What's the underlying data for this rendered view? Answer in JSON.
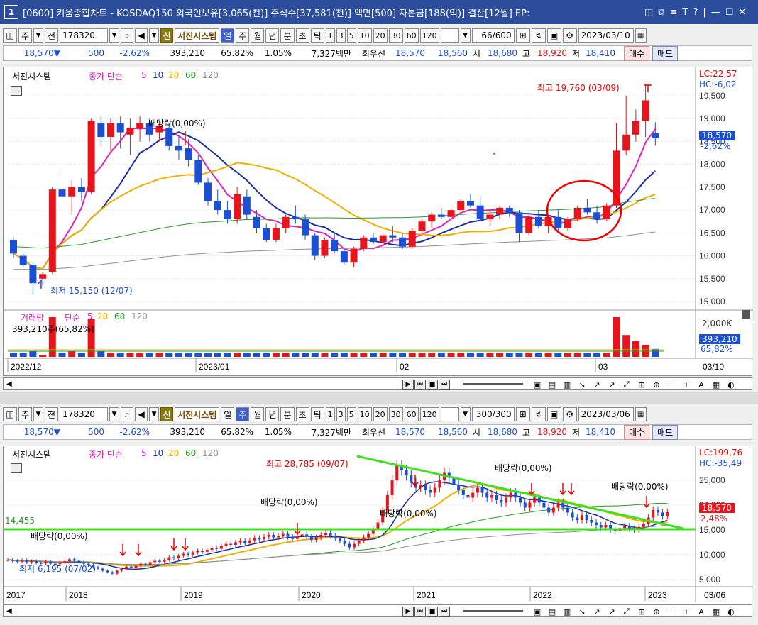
{
  "window": {
    "num": "1",
    "title": "[0600] 키움종합차트 - KOSDAQ150 외국인보유[3,065(천)] 주식수[37,581(천)] 액면[500] 자본금[188(억)] 결산[12월] EP:",
    "controls": [
      "◫",
      "⧉",
      "≡",
      "T",
      "?",
      "|",
      "—",
      "☐",
      "✕"
    ]
  },
  "panes": [
    {
      "toolbar": {
        "period": "주",
        "mode": "전",
        "code": "178320",
        "newbtn": "신",
        "system": "서진시스템",
        "tabs": [
          "일",
          "주",
          "월",
          "년",
          "분",
          "초",
          "틱"
        ],
        "sel": "일",
        "nums": [
          "1",
          "3",
          "5",
          "10",
          "20",
          "30",
          "60",
          "120"
        ],
        "count": "66/600",
        "date": "2023/03/10"
      },
      "info": {
        "price": "18,570▼",
        "chg": "500",
        "pct": "-2.62%",
        "vol": "393,210",
        "volpct": "65.82%",
        "turn": "1.05%",
        "amt": "7,327백만",
        "bestlabel": "최우선",
        "ask": "18,570",
        "bid": "18,560",
        "open_l": "시",
        "open": "18,680",
        "high_l": "고",
        "high": "18,920",
        "low_l": "저",
        "low": "18,410",
        "buy": "매수",
        "sell": "매도"
      },
      "legend": {
        "name": "서진시스템",
        "ma": "종가 단순",
        "ma5": "5",
        "ma10": "10",
        "ma20": "20",
        "ma60": "60",
        "ma120": "120"
      },
      "vol_legend": {
        "name": "거래량",
        "ma": "단순",
        "ma5": "5",
        "ma20": "20",
        "ma60": "60",
        "ma120": "120",
        "val": "393,210주(65,82%)"
      },
      "annot": {
        "high": "최고 19,760 (03/09)",
        "low": "최저 15,150 (12/07)",
        "div": "배당락(0,00%)",
        "lc": "LC:22,57",
        "hc": "HC:-6,02",
        "px": "18,570",
        "pxpct": "-2,62%",
        "vpx": "393,210",
        "vpct": "65,82%",
        "vmax": "2,000K"
      },
      "yticks": [
        "19,500",
        "19,000",
        "18,500",
        "18,000",
        "17,500",
        "17,000",
        "16,500",
        "16,000",
        "15,500",
        "15,000"
      ],
      "xticks": [
        "2022/12",
        "2023/01",
        "02",
        "03",
        "03/10"
      ]
    },
    {
      "toolbar": {
        "period": "주",
        "mode": "전",
        "code": "178320",
        "newbtn": "신",
        "system": "서진시스템",
        "tabs": [
          "일",
          "주",
          "월",
          "년",
          "분",
          "초",
          "틱"
        ],
        "sel": "주",
        "nums": [
          "1",
          "3",
          "5",
          "10",
          "20",
          "30",
          "60",
          "120"
        ],
        "count": "300/300",
        "date": "2023/03/06"
      },
      "info": {
        "price": "18,570▼",
        "chg": "500",
        "pct": "-2.62%",
        "vol": "393,210",
        "volpct": "65.82%",
        "turn": "1.05%",
        "amt": "7,327백만",
        "bestlabel": "최우선",
        "ask": "18,570",
        "bid": "18,560",
        "open_l": "시",
        "open": "18,680",
        "high_l": "고",
        "high": "18,920",
        "low_l": "저",
        "low": "18,410",
        "buy": "매수",
        "sell": "매도"
      },
      "legend": {
        "name": "서진시스템",
        "ma": "종가 단순",
        "ma5": "5",
        "ma10": "10",
        "ma20": "20",
        "ma60": "60",
        "ma120": "120"
      },
      "annot": {
        "high": "최고 28,785 (09/07)",
        "low": "최저 6,195 (07/02)",
        "div1": "배당락(0,00%)",
        "div2": "배당락(0,00%)",
        "div3": "배당락(0,00%)",
        "div4": "배당락(0,00%)",
        "div5": "배당락(0,00%)",
        "level": "14,455",
        "lc": "LC:199,76",
        "hc": "HC:-35,49",
        "px": "18,570",
        "pxpct": "2,48%"
      },
      "yticks": [
        "25,000",
        "20,000",
        "15,000",
        "10,000",
        "5,000"
      ],
      "xticks": [
        "2017",
        "2018",
        "2019",
        "2020",
        "2021",
        "2022",
        "2023",
        "03/06"
      ]
    }
  ],
  "colors": {
    "up": "#e8141b",
    "down": "#1a4fd6",
    "ma5": "#e020c0",
    "ma10": "#1a2fa0",
    "ma20": "#f0b000",
    "ma60": "#2a9a2a",
    "ma120": "#909090",
    "trend": "#40e020"
  },
  "chart_data": [
    {
      "type": "candlestick",
      "title": "서진시스템 일봉",
      "ylim": [
        15000,
        19760
      ],
      "candles": [
        [
          16350,
          16400,
          15950,
          16050
        ],
        [
          16000,
          16050,
          15750,
          15800
        ],
        [
          15800,
          15850,
          15150,
          15400
        ],
        [
          15500,
          15650,
          15350,
          15600
        ],
        [
          15650,
          17500,
          15600,
          17450
        ],
        [
          17450,
          17800,
          17100,
          17300
        ],
        [
          17300,
          17650,
          16900,
          17500
        ],
        [
          17500,
          17700,
          17200,
          17400
        ],
        [
          17400,
          19000,
          17350,
          18950
        ],
        [
          18900,
          19050,
          18400,
          18600
        ],
        [
          18600,
          19000,
          18300,
          18900
        ],
        [
          18900,
          19050,
          18350,
          18700
        ],
        [
          18650,
          19000,
          18200,
          18800
        ],
        [
          18800,
          19050,
          18500,
          18900
        ],
        [
          18900,
          19000,
          18500,
          18650
        ],
        [
          18700,
          18950,
          18500,
          18850
        ],
        [
          18800,
          18900,
          18300,
          18400
        ],
        [
          18400,
          18600,
          18100,
          18300
        ],
        [
          18350,
          18550,
          17950,
          18100
        ],
        [
          18100,
          18200,
          17550,
          17600
        ],
        [
          17600,
          17700,
          17100,
          17200
        ],
        [
          17200,
          17450,
          16900,
          17000
        ],
        [
          17000,
          17200,
          16700,
          16800
        ],
        [
          16800,
          17500,
          16700,
          17350
        ],
        [
          17300,
          17450,
          16800,
          16900
        ],
        [
          16850,
          17000,
          16500,
          16600
        ],
        [
          16600,
          16700,
          16300,
          16350
        ],
        [
          16350,
          16700,
          16300,
          16600
        ],
        [
          16600,
          16900,
          16500,
          16850
        ],
        [
          16850,
          17100,
          16700,
          16800
        ],
        [
          16800,
          16900,
          16350,
          16450
        ],
        [
          16450,
          16500,
          15900,
          16000
        ],
        [
          16000,
          16400,
          15950,
          16350
        ],
        [
          16350,
          16500,
          16050,
          16100
        ],
        [
          16100,
          16150,
          15800,
          15850
        ],
        [
          15850,
          16200,
          15750,
          16150
        ],
        [
          16150,
          16450,
          16100,
          16400
        ],
        [
          16400,
          16500,
          16250,
          16300
        ],
        [
          16300,
          16500,
          16200,
          16450
        ],
        [
          16450,
          16650,
          16300,
          16400
        ],
        [
          16400,
          16500,
          16150,
          16200
        ],
        [
          16200,
          16600,
          16150,
          16550
        ],
        [
          16550,
          16800,
          16500,
          16750
        ],
        [
          16750,
          16950,
          16600,
          16900
        ],
        [
          16900,
          17050,
          16800,
          16850
        ],
        [
          16850,
          17050,
          16750,
          17000
        ],
        [
          17000,
          17250,
          16950,
          17200
        ],
        [
          17200,
          17350,
          17050,
          17100
        ],
        [
          17100,
          17300,
          16750,
          16800
        ],
        [
          16800,
          17000,
          16650,
          16900
        ],
        [
          16900,
          17100,
          16800,
          17050
        ],
        [
          17050,
          17100,
          16850,
          16950
        ],
        [
          16950,
          17000,
          16300,
          16500
        ],
        [
          16500,
          16900,
          16450,
          16850
        ],
        [
          16850,
          17000,
          16600,
          16650
        ],
        [
          16650,
          16900,
          16500,
          16850
        ],
        [
          16850,
          17000,
          16500,
          16600
        ],
        [
          16600,
          16850,
          16550,
          16800
        ],
        [
          16800,
          17100,
          16750,
          17050
        ],
        [
          17050,
          17250,
          16900,
          16950
        ],
        [
          16950,
          17100,
          16700,
          16800
        ],
        [
          16800,
          17150,
          16750,
          17100
        ],
        [
          17100,
          18900,
          17050,
          18300
        ],
        [
          18300,
          19500,
          18200,
          18650
        ],
        [
          18650,
          19200,
          18500,
          18950
        ],
        [
          18950,
          19760,
          18600,
          19400
        ],
        [
          18680,
          18920,
          18410,
          18570
        ]
      ],
      "volume": [
        0.1,
        0.1,
        0.15,
        0.05,
        1.0,
        0.1,
        0.15,
        0.1,
        0.95,
        0.15,
        0.1,
        0.1,
        0.1,
        0.1,
        0.1,
        0.1,
        0.1,
        0.1,
        0.1,
        0.1,
        0.1,
        0.1,
        0.1,
        0.1,
        0.1,
        0.1,
        0.1,
        0.1,
        0.1,
        0.1,
        0.1,
        0.1,
        0.1,
        0.1,
        0.1,
        0.1,
        0.1,
        0.1,
        0.1,
        0.1,
        0.1,
        0.1,
        0.1,
        0.1,
        0.1,
        0.1,
        0.1,
        0.1,
        0.1,
        0.1,
        0.1,
        0.1,
        0.1,
        0.1,
        0.1,
        0.1,
        0.1,
        0.1,
        0.1,
        0.1,
        0.1,
        0.1,
        1.0,
        0.55,
        0.4,
        0.3,
        0.2
      ]
    },
    {
      "type": "candlestick",
      "title": "서진시스템 주봉",
      "ylim": [
        5000,
        28785
      ],
      "close": [
        9000,
        8800,
        8600,
        8900,
        8500,
        8700,
        8400,
        8300,
        8600,
        8200,
        8100,
        8400,
        8700,
        9100,
        8800,
        8500,
        8200,
        7900,
        7500,
        7200,
        6800,
        6500,
        6195,
        6800,
        7200,
        7600,
        7300,
        7800,
        8200,
        8000,
        8500,
        8800,
        8600,
        9000,
        9500,
        9300,
        9800,
        10200,
        10000,
        10500,
        10800,
        10600,
        11000,
        11400,
        11200,
        11800,
        12200,
        12000,
        12500,
        12800,
        12300,
        12900,
        13400,
        13100,
        13600,
        14000,
        13500,
        13800,
        14200,
        13600,
        13200,
        13700,
        14100,
        13600,
        13000,
        13500,
        14000,
        14400,
        13800,
        13300,
        12800,
        12200,
        11500,
        12200,
        12800,
        13500,
        14200,
        15200,
        16500,
        19000,
        22000,
        25000,
        28000,
        27000,
        26000,
        24500,
        23500,
        24000,
        23000,
        22500,
        23500,
        25000,
        26500,
        25500,
        24000,
        23000,
        22000,
        21500,
        22500,
        23500,
        22500,
        21500,
        22000,
        21000,
        20500,
        21500,
        22500,
        21500,
        20500,
        19500,
        20500,
        21500,
        20500,
        19500,
        18500,
        19500,
        20500,
        19500,
        18500,
        17500,
        17000,
        18000,
        17000,
        16500,
        16000,
        15500,
        16000,
        15000,
        14800,
        15400,
        15800,
        15300,
        15000,
        15600,
        16200,
        17500,
        19000,
        18500,
        17800,
        18570
      ]
    }
  ]
}
